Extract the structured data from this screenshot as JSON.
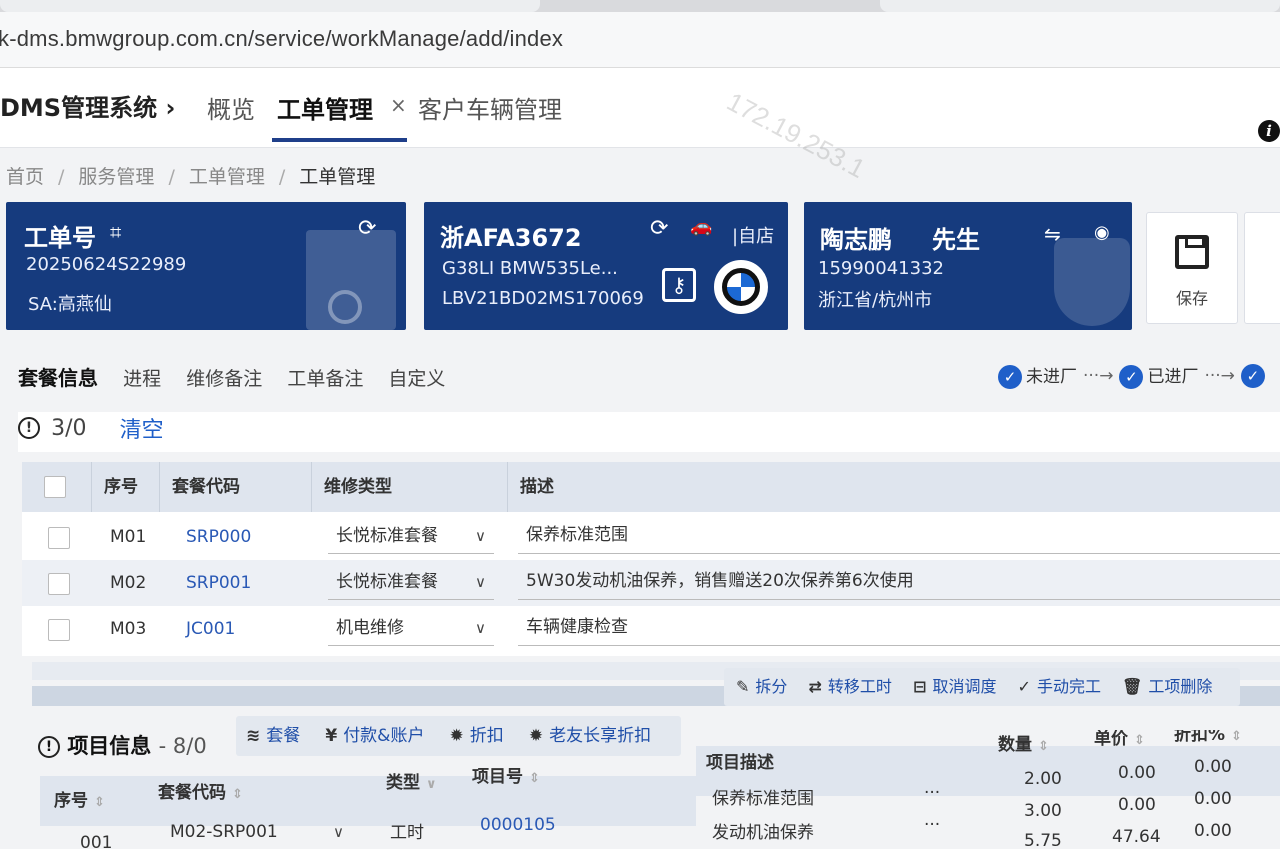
{
  "browser": {
    "url": "k-dms.bmwgroup.com.cn/service/workManage/add/index"
  },
  "nav": {
    "app_title": "DMS管理系统 ›",
    "tabs": [
      {
        "label": "概览"
      },
      {
        "label": "工单管理"
      },
      {
        "label": "客户车辆管理"
      }
    ],
    "close_glyph": "×",
    "info_glyph": "i"
  },
  "watermark": "172.19.253.1",
  "breadcrumb": [
    "首页",
    "服务管理",
    "工单管理",
    "工单管理"
  ],
  "breadcrumb_sep": "/",
  "order_card": {
    "title": "工单号",
    "order_no": "20250624S22989",
    "sa": "SA:高燕仙"
  },
  "vehicle_card": {
    "plate": "浙AFA3672",
    "model": "G38LI   BMW535Le...",
    "vin": "LBV21BD02MS170069",
    "source": "|自店"
  },
  "customer_card": {
    "name": "陶志鹏",
    "title": "先生",
    "phone": "15990041332",
    "region": "浙江省/杭州市"
  },
  "actions": {
    "save_label": "保存"
  },
  "section_tabs": [
    {
      "label": "套餐信息"
    },
    {
      "label": "进程"
    },
    {
      "label": "维修备注"
    },
    {
      "label": "工单备注"
    },
    {
      "label": "自定义"
    }
  ],
  "progress": {
    "steps": [
      "未进厂",
      "已进厂"
    ],
    "connector": "···→"
  },
  "package": {
    "count": "3/0",
    "clear_label": "清空",
    "headers": [
      "序号",
      "套餐代码",
      "维修类型",
      "描述"
    ],
    "rows": [
      {
        "seq": "M01",
        "code": "SRP000",
        "type": "长悦标准套餐",
        "desc": "保养标准范围"
      },
      {
        "seq": "M02",
        "code": "SRP001",
        "type": "长悦标准套餐",
        "desc": "5W30发动机油保养，销售赠送20次保养第6次使用"
      },
      {
        "seq": "M03",
        "code": "JC001",
        "type": "机电维修",
        "desc": "车辆健康检查"
      }
    ]
  },
  "item_toolbar_top": [
    {
      "icon": "✎",
      "label": "拆分"
    },
    {
      "icon": "⇄",
      "label": "转移工时"
    },
    {
      "icon": "⊟",
      "label": "取消调度"
    },
    {
      "icon": "✓",
      "label": "手动完工"
    },
    {
      "icon": "🗑",
      "label": "工项删除"
    }
  ],
  "items": {
    "title": "项目信息",
    "count": "- 8/0",
    "tools": [
      {
        "icon": "≋",
        "label": "套餐"
      },
      {
        "icon": "¥",
        "label": "付款&账户"
      },
      {
        "icon": "✹",
        "label": "折扣"
      },
      {
        "icon": "✹",
        "label": "老友长享折扣"
      }
    ],
    "headers": {
      "seq": "序号",
      "code": "套餐代码",
      "type": "类型",
      "item_no": "项目号",
      "desc": "项目描述",
      "qty": "数量",
      "price": "单价",
      "discount": "折扣%"
    },
    "rows": [
      {
        "seq": "001",
        "code": "M02-SRP001",
        "type": "工时",
        "item_no": "0000105",
        "desc": "保养标准范围",
        "qty": "2.00",
        "price": "0.00",
        "discount": "0.00"
      },
      {
        "seq": "",
        "code": "",
        "type": "",
        "item_no": "",
        "desc": "发动机油保养",
        "qty": "3.00",
        "price": "0.00",
        "discount": "0.00"
      },
      {
        "seq": "",
        "code": "",
        "type": "",
        "item_no": "",
        "desc": "",
        "qty": "5.75",
        "price": "47.64",
        "discount": "0.00"
      }
    ],
    "more_glyph": "···"
  },
  "colors": {
    "card_blue": "#163b7e",
    "accent_blue": "#1f5fc9",
    "link_blue": "#2a59b5"
  }
}
